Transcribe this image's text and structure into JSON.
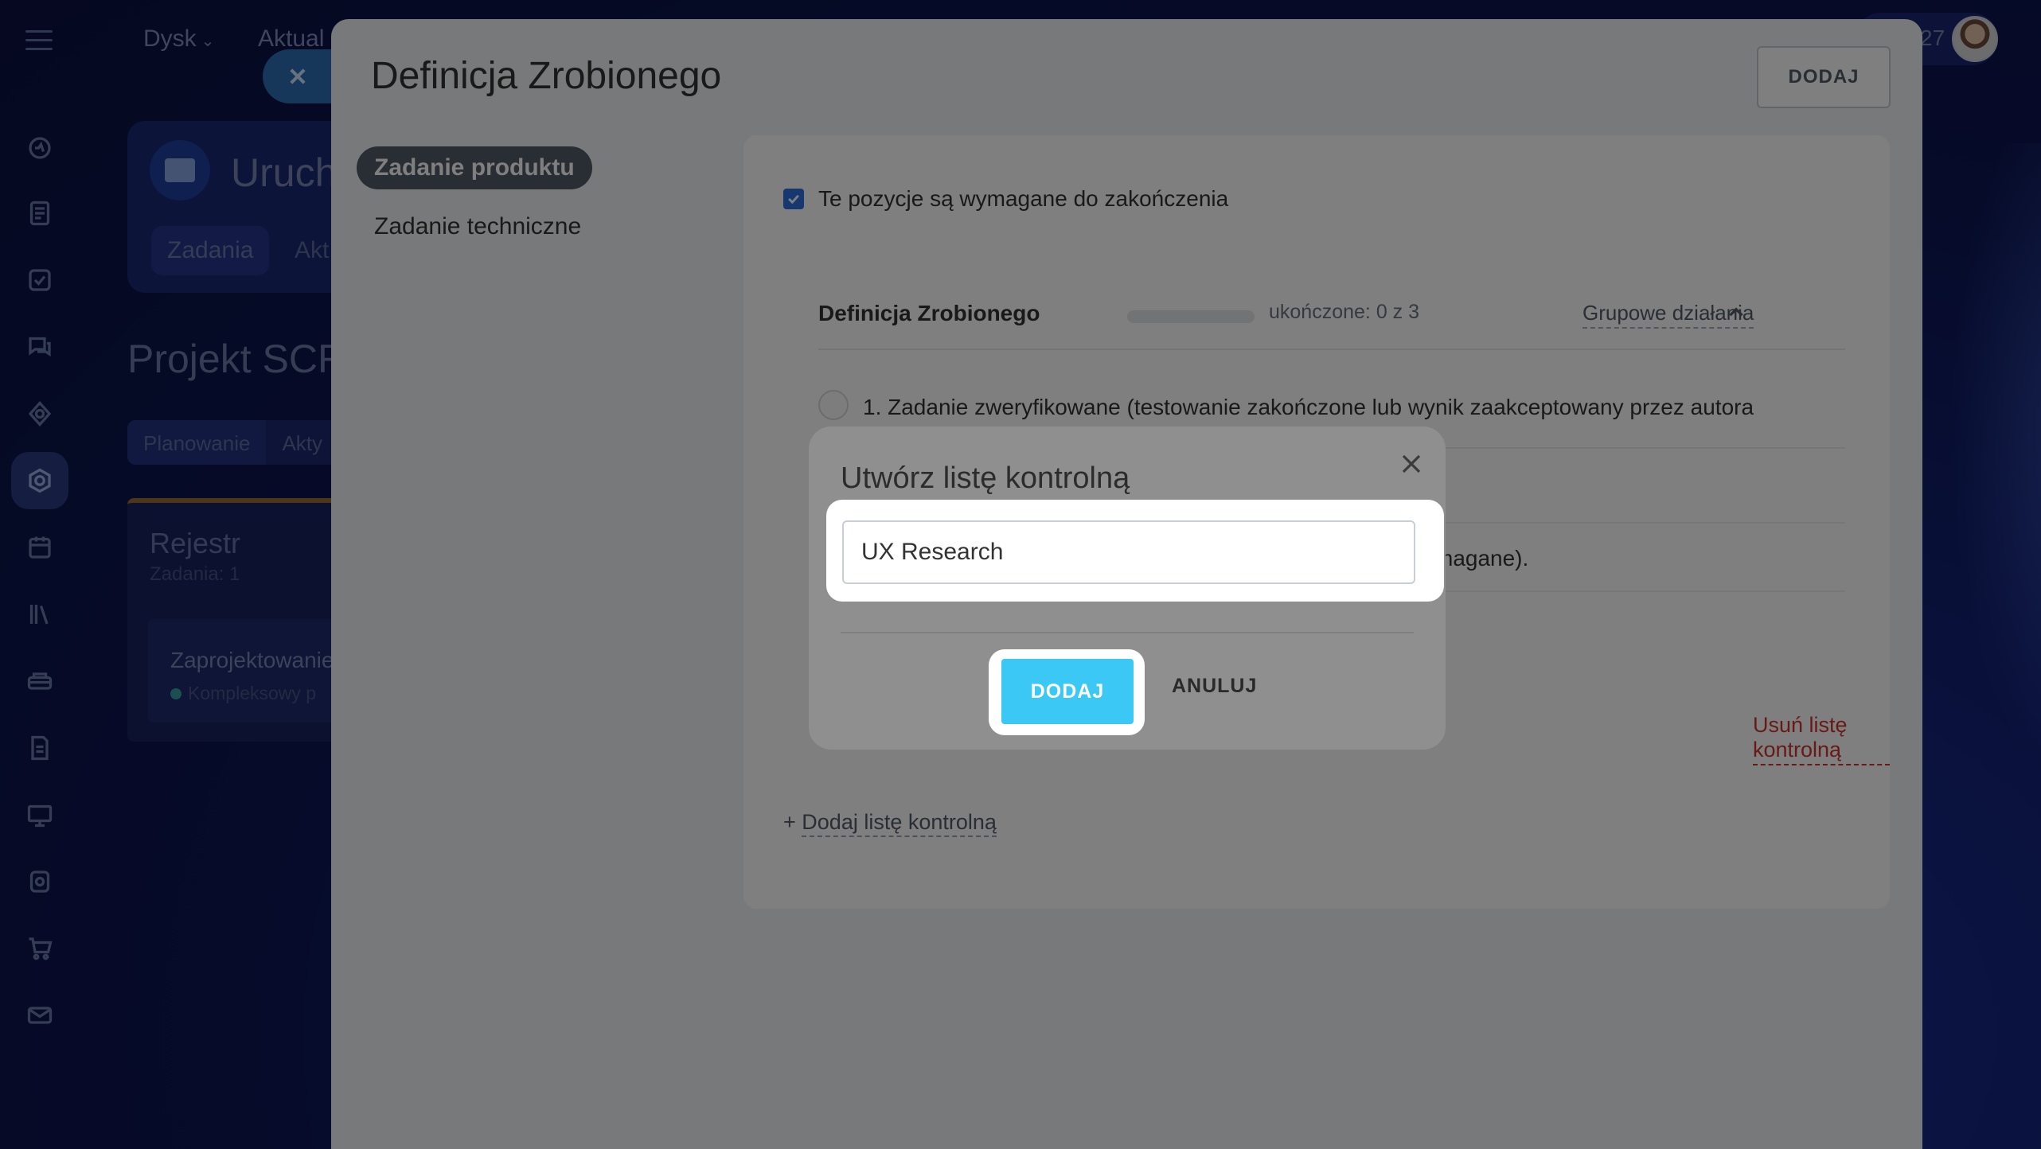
{
  "background": {
    "top_nav": {
      "disk_label": "Dysk",
      "news_label": "Aktual"
    },
    "project_card": {
      "title": "Uruch",
      "tab_tasks": "Zadania",
      "tab_other": "Akt"
    },
    "project_heading": "Projekt SCR",
    "planning_tabs": [
      "Planowanie",
      "Akty"
    ],
    "backlog": {
      "title": "Rejestr",
      "subtitle": "Zadania: 1",
      "item_title": "Zaprojektowanie",
      "item_subtitle": "Kompleksowy p"
    },
    "user_chip": {
      "number": "27"
    }
  },
  "slider": {
    "title": "Definicja Zrobionego",
    "add_button": "DODAJ",
    "side_menu": [
      {
        "label": "Zadanie produktu",
        "active": true
      },
      {
        "label": "Zadanie techniczne",
        "active": false
      }
    ],
    "required_checkbox_label": "Te pozycje są wymagane do zakończenia",
    "checklist": {
      "title": "Definicja Zrobionego",
      "progress": "ukończone: 0 z 3",
      "group_actions": "Grupowe działania",
      "items": [
        "1. Zadanie zweryfikowane (testowanie zakończone lub wynik zaakceptowany przez autora",
        "",
        "magane)."
      ]
    },
    "delete_checklist": "Usuń listę kontrolną",
    "add_checklist_prefix": "+",
    "add_checklist": "Dodaj listę kontrolną"
  },
  "popup": {
    "title": "Utwórz listę kontrolną",
    "input_value": "UX Research",
    "add_button": "DODAJ",
    "cancel_button": "ANULUJ"
  },
  "colors": {
    "accent": "#3bc8f5",
    "danger": "#d0342c",
    "checkbox": "#2f6fe0"
  }
}
